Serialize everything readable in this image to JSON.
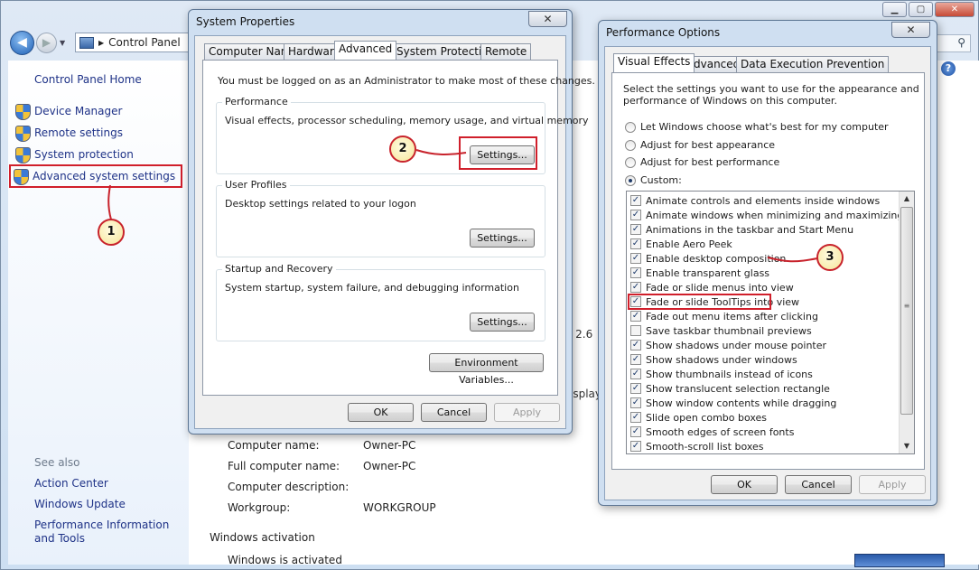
{
  "control_panel": {
    "address": "Control Panel",
    "home": "Control Panel Home",
    "tasks": [
      "Device Manager",
      "Remote settings",
      "System protection",
      "Advanced system settings"
    ],
    "see_also_heading": "See also",
    "see_also": [
      "Action Center",
      "Windows Update",
      "Performance Information and Tools"
    ],
    "system_info": {
      "computer_name_label": "Computer name:",
      "computer_name": "Owner-PC",
      "full_name_label": "Full computer name:",
      "full_name": "Owner-PC",
      "description_label": "Computer description:",
      "workgroup_label": "Workgroup:",
      "workgroup": "WORKGROUP"
    },
    "activation_heading": "Windows activation",
    "activation_status": "Windows is activated",
    "clipped": {
      "ghz": "z 2.6",
      "display": "isplay"
    }
  },
  "system_properties": {
    "title": "System Properties",
    "close": "✕",
    "tabs": [
      "Computer Name",
      "Hardware",
      "Advanced",
      "System Protection",
      "Remote"
    ],
    "admin_note": "You must be logged on as an Administrator to make most of these changes.",
    "performance": {
      "label": "Performance",
      "desc": "Visual effects, processor scheduling, memory usage, and virtual memory",
      "button": "Settings..."
    },
    "user_profiles": {
      "label": "User Profiles",
      "desc": "Desktop settings related to your logon",
      "button": "Settings..."
    },
    "startup": {
      "label": "Startup and Recovery",
      "desc": "System startup, system failure, and debugging information",
      "button": "Settings..."
    },
    "env_button": "Environment Variables...",
    "ok": "OK",
    "cancel": "Cancel",
    "apply": "Apply"
  },
  "performance_options": {
    "title": "Performance Options",
    "close": "✕",
    "tabs": [
      "Visual Effects",
      "Advanced",
      "Data Execution Prevention"
    ],
    "intro": [
      "Select the settings you want to use for the appearance and",
      "performance of Windows on this computer."
    ],
    "radios": [
      {
        "label": "Let Windows choose what's best for my computer",
        "selected": false
      },
      {
        "label": "Adjust for best appearance",
        "selected": false
      },
      {
        "label": "Adjust for best performance",
        "selected": false
      },
      {
        "label": "Custom:",
        "selected": true
      }
    ],
    "effects": [
      {
        "label": "Animate controls and elements inside windows",
        "checked": true
      },
      {
        "label": "Animate windows when minimizing and maximizing",
        "checked": true
      },
      {
        "label": "Animations in the taskbar and Start Menu",
        "checked": true
      },
      {
        "label": "Enable Aero Peek",
        "checked": true
      },
      {
        "label": "Enable desktop composition",
        "checked": true
      },
      {
        "label": "Enable transparent glass",
        "checked": true
      },
      {
        "label": "Fade or slide menus into view",
        "checked": true
      },
      {
        "label": "Fade or slide ToolTips into view",
        "checked": true
      },
      {
        "label": "Fade out menu items after clicking",
        "checked": true
      },
      {
        "label": "Save taskbar thumbnail previews",
        "checked": false
      },
      {
        "label": "Show shadows under mouse pointer",
        "checked": true
      },
      {
        "label": "Show shadows under windows",
        "checked": true
      },
      {
        "label": "Show thumbnails instead of icons",
        "checked": true
      },
      {
        "label": "Show translucent selection rectangle",
        "checked": true
      },
      {
        "label": "Show window contents while dragging",
        "checked": true
      },
      {
        "label": "Slide open combo boxes",
        "checked": true
      },
      {
        "label": "Smooth edges of screen fonts",
        "checked": true
      },
      {
        "label": "Smooth-scroll list boxes",
        "checked": true
      }
    ],
    "ok": "OK",
    "cancel": "Cancel",
    "apply": "Apply"
  },
  "annotations": [
    "1",
    "2",
    "3"
  ],
  "colors": {
    "annotation_red": "#d01f2b",
    "link_blue": "#1e3287"
  }
}
